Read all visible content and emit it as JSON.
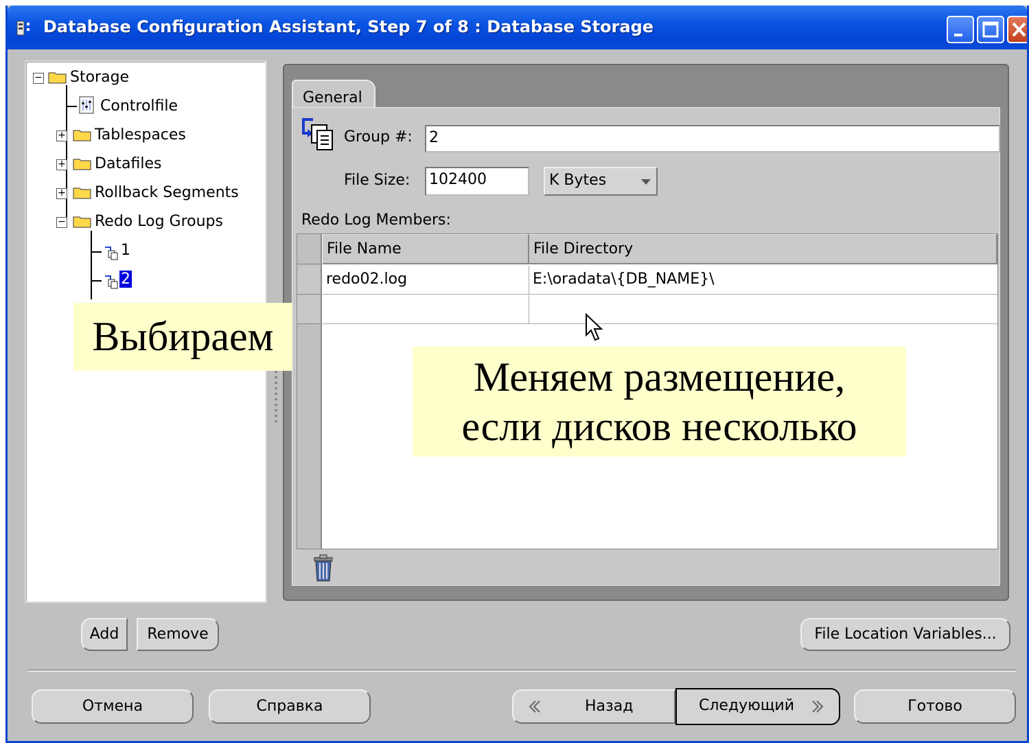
{
  "window": {
    "title": "Database Configuration Assistant, Step 7 of 8 : Database Storage"
  },
  "tree": {
    "root": "Storage",
    "items": [
      {
        "label": "Controlfile"
      },
      {
        "label": "Tablespaces"
      },
      {
        "label": "Datafiles"
      },
      {
        "label": "Rollback Segments"
      },
      {
        "label": "Redo Log Groups"
      }
    ],
    "children": [
      "1",
      "2"
    ],
    "selected": "2"
  },
  "tabs": {
    "general": "General"
  },
  "form": {
    "group_label": "Group #:",
    "group_value": "2",
    "filesize_label": "File Size:",
    "filesize_value": "102400",
    "unit_value": "K Bytes",
    "members_label": "Redo Log Members:"
  },
  "grid": {
    "columns": [
      "File Name",
      "File Directory"
    ],
    "rows": [
      [
        "redo02.log",
        "E:\\oradata\\{DB_NAME}\\"
      ],
      [
        "",
        ""
      ]
    ]
  },
  "buttons": {
    "add": "Add",
    "remove": "Remove",
    "file_location": "File Location Variables...",
    "cancel": "Отмена",
    "help": "Справка",
    "back": "Назад",
    "next": "Следующий",
    "finish": "Готово"
  },
  "callouts": {
    "select": "Выбираем",
    "change_line1": "Меняем размещение,",
    "change_line2": "если дисков несколько"
  }
}
